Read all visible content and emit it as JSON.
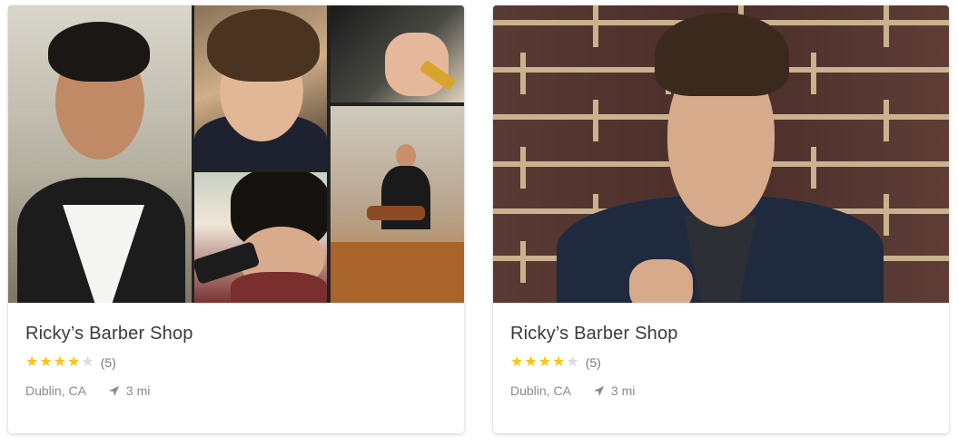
{
  "cards": [
    {
      "title": "Ricky’s Barber Shop",
      "rating": 4,
      "max_rating": 5,
      "review_count": "(5)",
      "location": "Dublin, CA",
      "distance": "3 mi"
    },
    {
      "title": "Ricky’s Barber Shop",
      "rating": 4,
      "max_rating": 5,
      "review_count": "(5)",
      "location": "Dublin, CA",
      "distance": "3 mi"
    }
  ],
  "colors": {
    "star_on": "#f5c518",
    "star_off": "#dcdcdc",
    "title_text": "#3a3a3a",
    "muted_text": "#8a8a8a"
  },
  "icons": {
    "star": "star-icon",
    "distance": "navigation-arrow-icon"
  }
}
